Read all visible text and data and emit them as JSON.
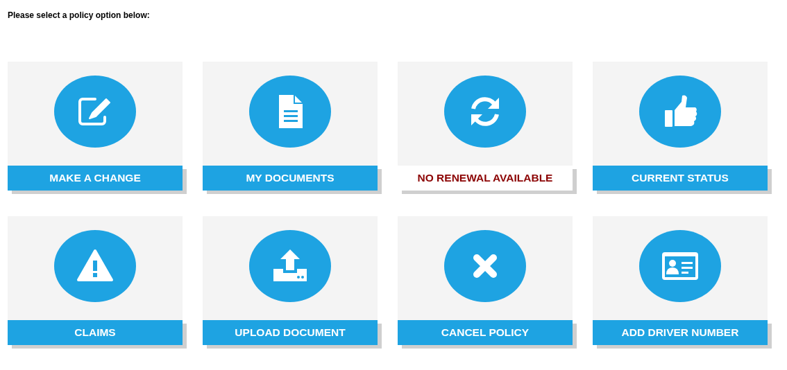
{
  "heading": "Please select a policy option below:",
  "options": [
    {
      "label": "MAKE A CHANGE",
      "available": true
    },
    {
      "label": "MY DOCUMENTS",
      "available": true
    },
    {
      "label": "NO RENEWAL AVAILABLE",
      "available": false
    },
    {
      "label": "CURRENT STATUS",
      "available": true
    },
    {
      "label": "CLAIMS",
      "available": true
    },
    {
      "label": "UPLOAD DOCUMENT",
      "available": true
    },
    {
      "label": "CANCEL POLICY",
      "available": true
    },
    {
      "label": "ADD DRIVER NUMBER",
      "available": true
    }
  ]
}
